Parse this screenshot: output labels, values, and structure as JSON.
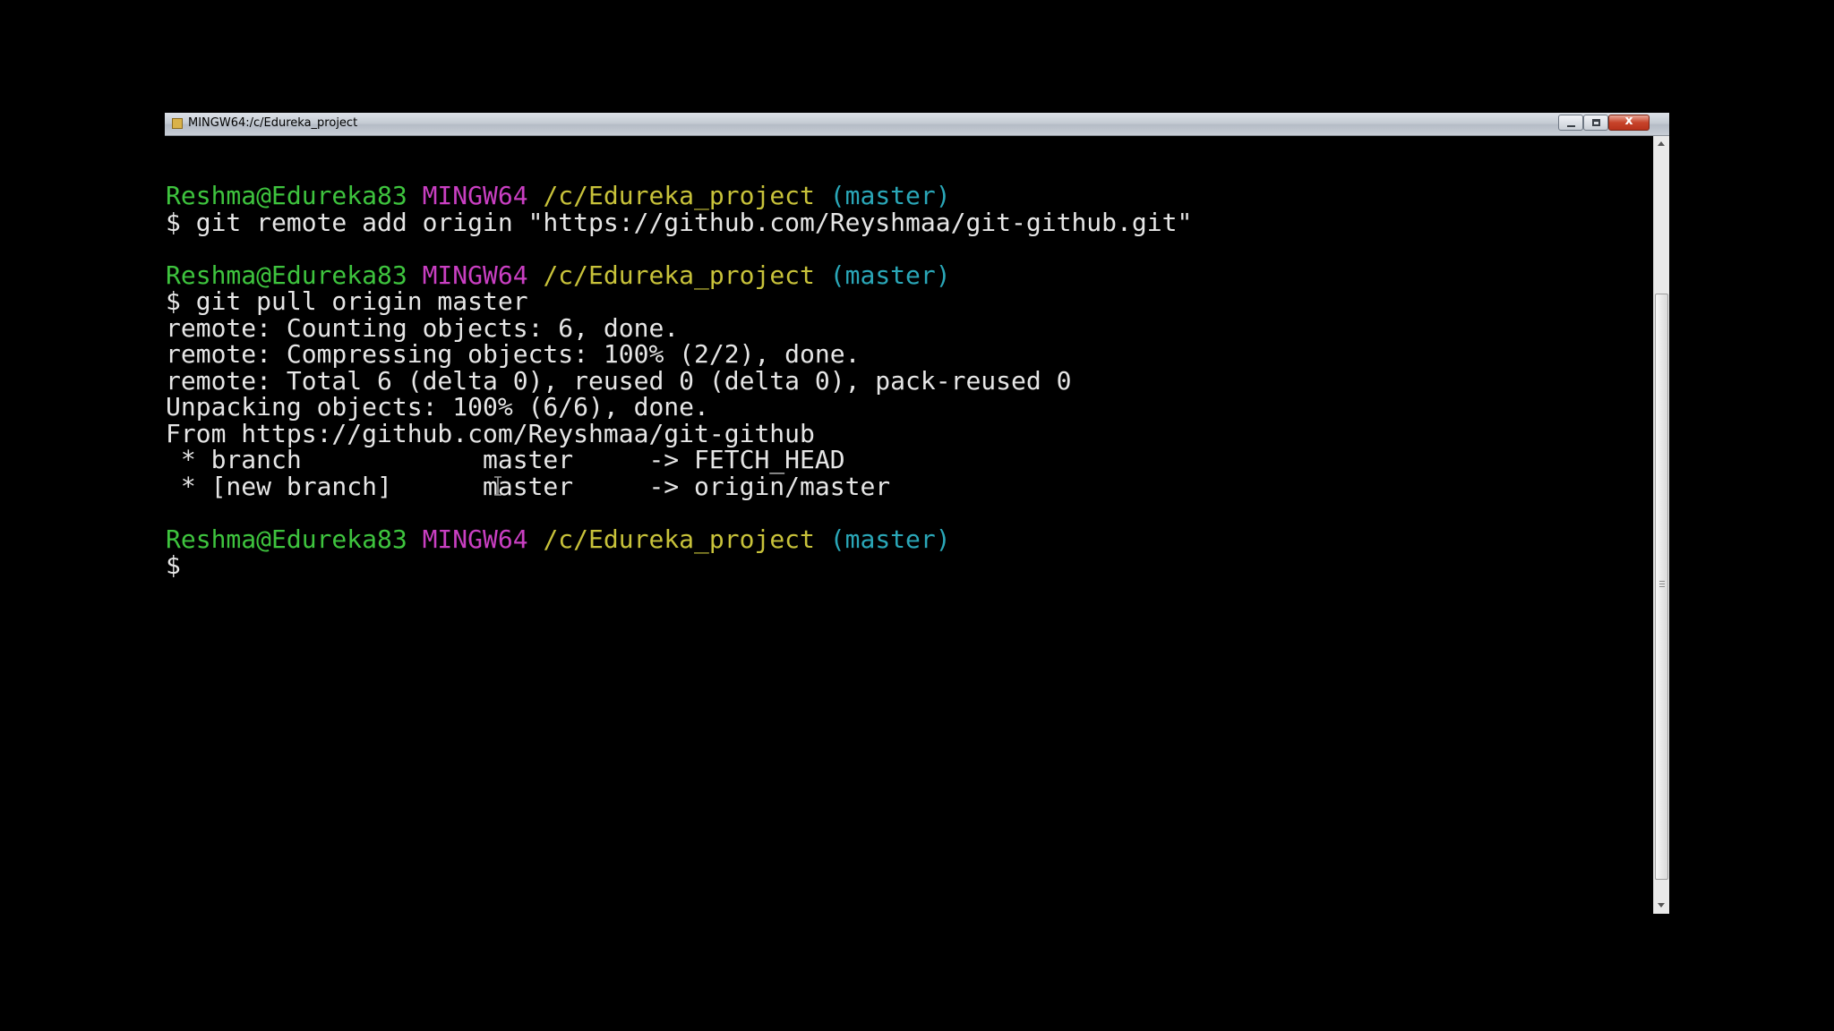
{
  "window": {
    "title": "MINGW64:/c/Edureka_project",
    "close_glyph": "x"
  },
  "prompt": {
    "user_host": "Reshma@Edureka83",
    "system": "MINGW64",
    "path": "/c/Edureka_project",
    "branch": "(master)"
  },
  "console": {
    "command_1": "$ git remote add origin \"https://github.com/Reyshmaa/git-github.git\"",
    "command_2": "$ git pull origin master",
    "output": [
      "remote: Counting objects: 6, done.",
      "remote: Compressing objects: 100% (2/2), done.",
      "remote: Total 6 (delta 0), reused 0 (delta 0), pack-reused 0",
      "Unpacking objects: 100% (6/6), done.",
      "From https://github.com/Reyshmaa/git-github",
      " * branch            master     -> FETCH_HEAD",
      " * [new branch]      master     -> origin/master"
    ],
    "current_input": "$"
  },
  "colors": {
    "user_host": "#3ec43e",
    "system": "#c93fc2",
    "path": "#c8c23a",
    "branch": "#2aa7b8",
    "text": "#e6e6e6",
    "background": "#000000"
  },
  "icons": {
    "app": "terminal-icon",
    "cursor": "i-beam-cursor-icon"
  }
}
